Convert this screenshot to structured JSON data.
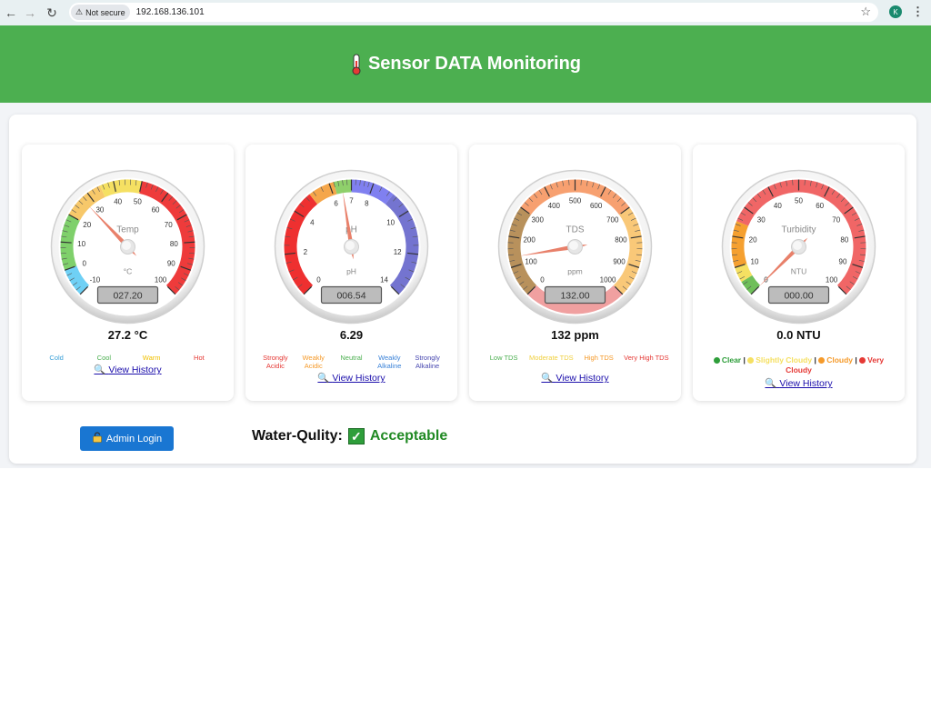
{
  "browser": {
    "security": "Not secure",
    "url": "192.168.136.101",
    "profile_initial": "K"
  },
  "header": {
    "title": "Sensor DATA Monitoring"
  },
  "gauges": [
    {
      "key": "temp",
      "title": "Temp",
      "unit": "°C",
      "min": -10,
      "max": 100,
      "ticks": [
        -10,
        0,
        10,
        20,
        30,
        40,
        50,
        60,
        70,
        80,
        90,
        100
      ],
      "value": 27.2,
      "display": "027.20",
      "reading": "27.2 °C",
      "sweep_deg": 270,
      "bands": [
        {
          "from": -10,
          "to": 0,
          "color": "#6fd0f5"
        },
        {
          "from": 0,
          "to": 20,
          "color": "#7fd06b"
        },
        {
          "from": 20,
          "to": 35,
          "color": "#f7c86a"
        },
        {
          "from": 35,
          "to": 50,
          "color": "#f5e062"
        },
        {
          "from": 50,
          "to": 100,
          "color": "#ee3b3b"
        }
      ],
      "legend": [
        {
          "label": "Cold",
          "color": "#3aa0d8"
        },
        {
          "label": "Cool",
          "color": "#4caf50"
        },
        {
          "label": "Warm",
          "color": "#f0c000"
        },
        {
          "label": "Hot",
          "color": "#e53935"
        }
      ],
      "history": "View History"
    },
    {
      "key": "ph",
      "title": "pH",
      "unit": "pH",
      "min": 0,
      "max": 14,
      "ticks": [
        0,
        2,
        4,
        6,
        7,
        8,
        10,
        12,
        14
      ],
      "value": 6.54,
      "display": "006.54",
      "reading": "6.29",
      "sweep_deg": 270,
      "bands": [
        {
          "from": 0,
          "to": 5,
          "color": "#ee3030"
        },
        {
          "from": 5,
          "to": 6.2,
          "color": "#f5a64a"
        },
        {
          "from": 6.2,
          "to": 7,
          "color": "#8fd06b"
        },
        {
          "from": 7,
          "to": 9,
          "color": "#8080f0"
        },
        {
          "from": 9,
          "to": 14,
          "color": "#7474d0"
        }
      ],
      "legend": [
        {
          "label": "Strongly Acidic",
          "color": "#e53935"
        },
        {
          "label": "Weakly Acidic",
          "color": "#f59a2a"
        },
        {
          "label": "Neutral",
          "color": "#4caf50"
        },
        {
          "label": "Weakly Alkaline",
          "color": "#3a82d8"
        },
        {
          "label": "Strongly Alkaline",
          "color": "#4848b0"
        }
      ],
      "history": "View History"
    },
    {
      "key": "tds",
      "title": "TDS",
      "unit": "ppm",
      "min": 0,
      "max": 1000,
      "ticks": [
        0,
        100,
        200,
        300,
        400,
        500,
        600,
        700,
        800,
        900,
        1000
      ],
      "value": 132,
      "display": "132.00",
      "reading": "132 ppm",
      "sweep_deg": 270,
      "bands": [
        {
          "from": 0,
          "to": 300,
          "color": "#b8915c"
        },
        {
          "from": 300,
          "to": 700,
          "color": "#f7a070"
        },
        {
          "from": 700,
          "to": 1000,
          "color": "#f9c878"
        }
      ],
      "bottom_band_color": "#f0a0a0",
      "legend": [
        {
          "label": "Low TDS",
          "color": "#4caf50"
        },
        {
          "label": "Moderate TDS",
          "color": "#f0d040"
        },
        {
          "label": "High TDS",
          "color": "#f59a2a"
        },
        {
          "label": "Very High TDS",
          "color": "#e53935"
        }
      ],
      "history": "View History"
    },
    {
      "key": "turbidity",
      "title": "Turbidity",
      "unit": "NTU",
      "min": 0,
      "max": 100,
      "ticks": [
        0,
        10,
        20,
        30,
        40,
        50,
        60,
        70,
        80,
        90,
        100
      ],
      "value": 0,
      "display": "000.00",
      "reading": "0.0 NTU",
      "sweep_deg": 270,
      "bands": [
        {
          "from": 0,
          "to": 5,
          "color": "#6fbf5a"
        },
        {
          "from": 5,
          "to": 10,
          "color": "#f5e062"
        },
        {
          "from": 10,
          "to": 25,
          "color": "#f5a030"
        },
        {
          "from": 25,
          "to": 100,
          "color": "#f06666"
        }
      ],
      "turbidity_legend": [
        {
          "label": "Clear",
          "color": "#2e9e3a"
        },
        {
          "label": "Slightly Cloudy",
          "color": "#f5e062"
        },
        {
          "label": "Cloudy",
          "color": "#f59a2a"
        },
        {
          "label": "Very Cloudy",
          "color": "#e53935"
        }
      ],
      "history": "View History"
    }
  ],
  "footer": {
    "admin_label": "Admin Login",
    "quality_label": "Water-Qulity:",
    "quality_status": "Acceptable"
  }
}
